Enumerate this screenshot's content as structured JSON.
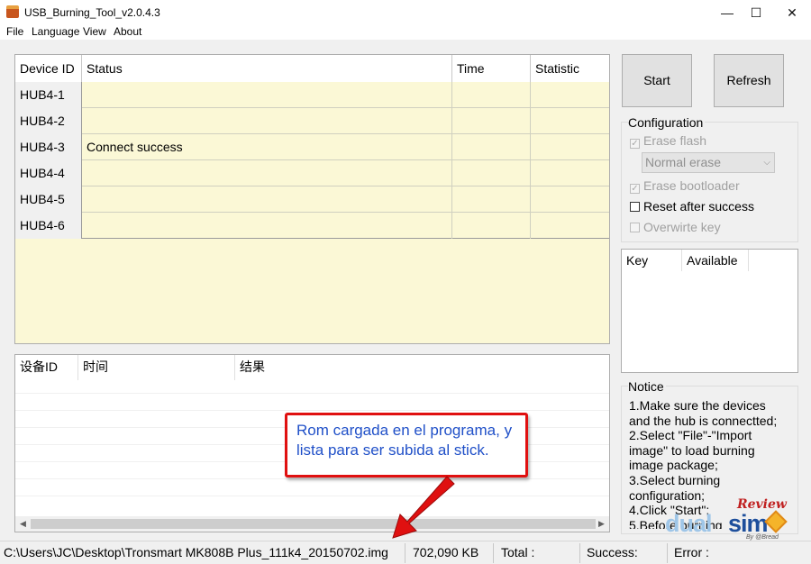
{
  "window": {
    "title": "USB_Burning_Tool_v2.0.4.3",
    "controls": {
      "minimize": "—",
      "maximize": "☐",
      "close": "✕"
    }
  },
  "menu": [
    "File",
    "Language",
    "View",
    "About"
  ],
  "device_table": {
    "columns": [
      "Device ID",
      "Status",
      "Time",
      "Statistic"
    ],
    "rows": [
      {
        "id": "HUB4-1",
        "status": "",
        "time": "",
        "statistic": ""
      },
      {
        "id": "HUB4-2",
        "status": "",
        "time": "",
        "statistic": ""
      },
      {
        "id": "HUB4-3",
        "status": "Connect success",
        "time": "",
        "statistic": ""
      },
      {
        "id": "HUB4-4",
        "status": "",
        "time": "",
        "statistic": ""
      },
      {
        "id": "HUB4-5",
        "status": "",
        "time": "",
        "statistic": ""
      },
      {
        "id": "HUB4-6",
        "status": "",
        "time": "",
        "statistic": ""
      }
    ]
  },
  "log_table": {
    "columns": [
      "设备ID",
      "时间",
      "结果"
    ]
  },
  "buttons": {
    "start": "Start",
    "refresh": "Refresh"
  },
  "configuration": {
    "label": "Configuration",
    "erase_flash": {
      "label": "Erase flash",
      "checked": true,
      "enabled": false
    },
    "erase_mode": {
      "value": "Normal erase",
      "enabled": false
    },
    "erase_bootloader": {
      "label": "Erase bootloader",
      "checked": true,
      "enabled": false
    },
    "reset_after_success": {
      "label": "Reset after success",
      "checked": false,
      "enabled": true
    },
    "overwrite_key": {
      "label": "Overwirte key",
      "checked": false,
      "enabled": false
    }
  },
  "key_table": {
    "columns": [
      "Key",
      "Available"
    ]
  },
  "notice": {
    "label": "Notice",
    "lines": [
      "1.Make sure the devices and the hub is connectted;",
      "2.Select \"File\"-\"Import image\" to load burning image package;",
      "3.Select burning configuration;",
      "4.Click \"Start\";",
      "5.Before burning"
    ]
  },
  "status_bar": {
    "image_path": "C:\\Users\\JC\\Desktop\\Tronsmart MK808B Plus_111k4_20150702.img",
    "size": "702,090 KB",
    "total_label": "Total :",
    "success_label": "Success:",
    "error_label": "Error :"
  },
  "callout": {
    "text": "Rom cargada en el programa, y lista para ser subida al stick.",
    "border_color": "#e01010",
    "text_color": "#2050c8"
  },
  "watermark": {
    "review": "Review",
    "brand_light": "dual",
    "brand_dark": "sim",
    "by": "By @Bread"
  }
}
